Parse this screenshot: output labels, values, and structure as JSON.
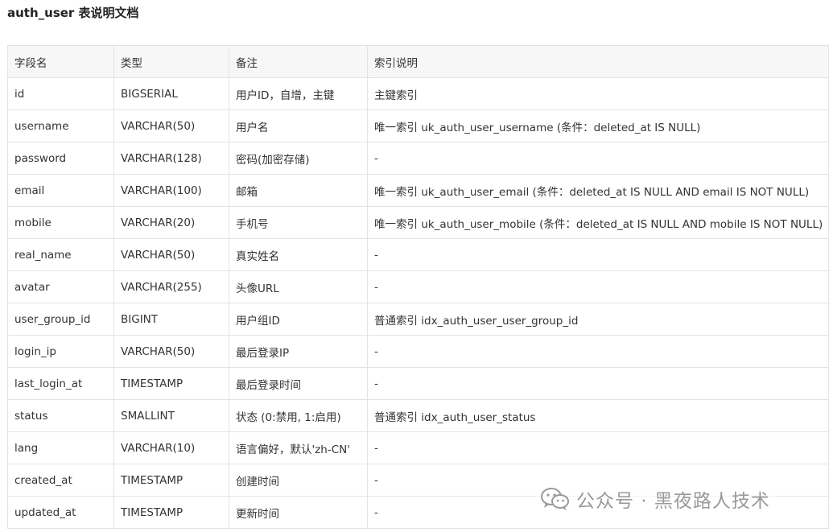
{
  "title": "auth_user 表说明文档",
  "columns": [
    "字段名",
    "类型",
    "备注",
    "索引说明"
  ],
  "rows": [
    {
      "field": "id",
      "type": "BIGSERIAL",
      "note": "用户ID，自增，主键",
      "index": "主键索引"
    },
    {
      "field": "username",
      "type": "VARCHAR(50)",
      "note": "用户名",
      "index": "唯一索引 uk_auth_user_username (条件：deleted_at IS NULL)"
    },
    {
      "field": "password",
      "type": "VARCHAR(128)",
      "note": "密码(加密存储)",
      "index": "-"
    },
    {
      "field": "email",
      "type": "VARCHAR(100)",
      "note": "邮箱",
      "index": "唯一索引 uk_auth_user_email (条件：deleted_at IS NULL AND email IS NOT NULL)"
    },
    {
      "field": "mobile",
      "type": "VARCHAR(20)",
      "note": "手机号",
      "index": "唯一索引 uk_auth_user_mobile (条件：deleted_at IS NULL AND mobile IS NOT NULL)"
    },
    {
      "field": "real_name",
      "type": "VARCHAR(50)",
      "note": "真实姓名",
      "index": "-"
    },
    {
      "field": "avatar",
      "type": "VARCHAR(255)",
      "note": "头像URL",
      "index": "-"
    },
    {
      "field": "user_group_id",
      "type": "BIGINT",
      "note": "用户组ID",
      "index": "普通索引 idx_auth_user_user_group_id"
    },
    {
      "field": "login_ip",
      "type": "VARCHAR(50)",
      "note": "最后登录IP",
      "index": "-"
    },
    {
      "field": "last_login_at",
      "type": "TIMESTAMP",
      "note": "最后登录时间",
      "index": "-"
    },
    {
      "field": "status",
      "type": "SMALLINT",
      "note": "状态 (0:禁用, 1:启用)",
      "index": "普通索引 idx_auth_user_status"
    },
    {
      "field": "lang",
      "type": "VARCHAR(10)",
      "note": "语言偏好，默认'zh-CN'",
      "index": "-"
    },
    {
      "field": "created_at",
      "type": "TIMESTAMP",
      "note": "创建时间",
      "index": "-"
    },
    {
      "field": "updated_at",
      "type": "TIMESTAMP",
      "note": "更新时间",
      "index": "-"
    }
  ],
  "watermark": {
    "text": "公众号 · 黑夜路人技术",
    "icon": "wechat-icon"
  },
  "colors": {
    "border": "#e3e3e3",
    "header_bg": "#f7f7f7",
    "text": "#333333",
    "watermark": "#9a9a9a"
  }
}
